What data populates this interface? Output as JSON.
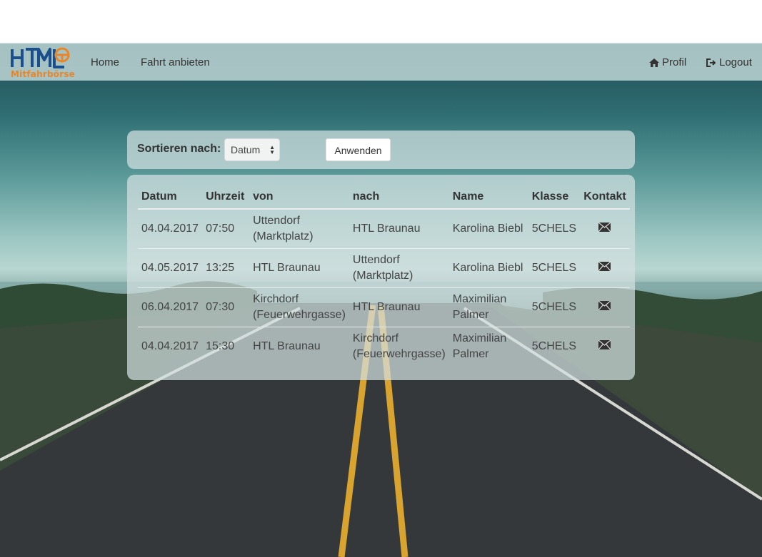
{
  "navbar": {
    "logo_text": "Mitfahrbörse",
    "links": [
      "Home",
      "Fahrt anbieten"
    ],
    "profil": "Profil",
    "logout": "Logout"
  },
  "sort": {
    "label": "Sortieren nach:",
    "selected": "Datum",
    "apply": "Anwenden"
  },
  "table": {
    "headers": [
      "Datum",
      "Uhrzeit",
      "von",
      "nach",
      "Name",
      "Klasse",
      "Kontakt"
    ],
    "rows": [
      {
        "datum": "04.04.2017",
        "uhrzeit": "07:50",
        "von": "Uttendorf (Marktplatz)",
        "nach": "HTL Braunau",
        "name": "Karolina Biebl",
        "klasse": "5CHELS"
      },
      {
        "datum": "04.05.2017",
        "uhrzeit": "13:25",
        "von": "HTL Braunau",
        "nach": "Uttendorf (Marktplatz)",
        "name": "Karolina Biebl",
        "klasse": "5CHELS"
      },
      {
        "datum": "06.04.2017",
        "uhrzeit": "07:30",
        "von": "Kirchdorf (Feuerwehrgasse)",
        "nach": "HTL Braunau",
        "name": "Maximilian Palmer",
        "klasse": "5CHELS"
      },
      {
        "datum": "04.04.2017",
        "uhrzeit": "15:30",
        "von": "HTL Braunau",
        "nach": "Kirchdorf (Feuerwehrgasse)",
        "name": "Maximilian Palmer",
        "klasse": "5CHELS"
      }
    ]
  },
  "colors": {
    "logo_blue": "#1a4f8c",
    "logo_orange": "#e8862a",
    "road_line": "#d9a32f"
  }
}
